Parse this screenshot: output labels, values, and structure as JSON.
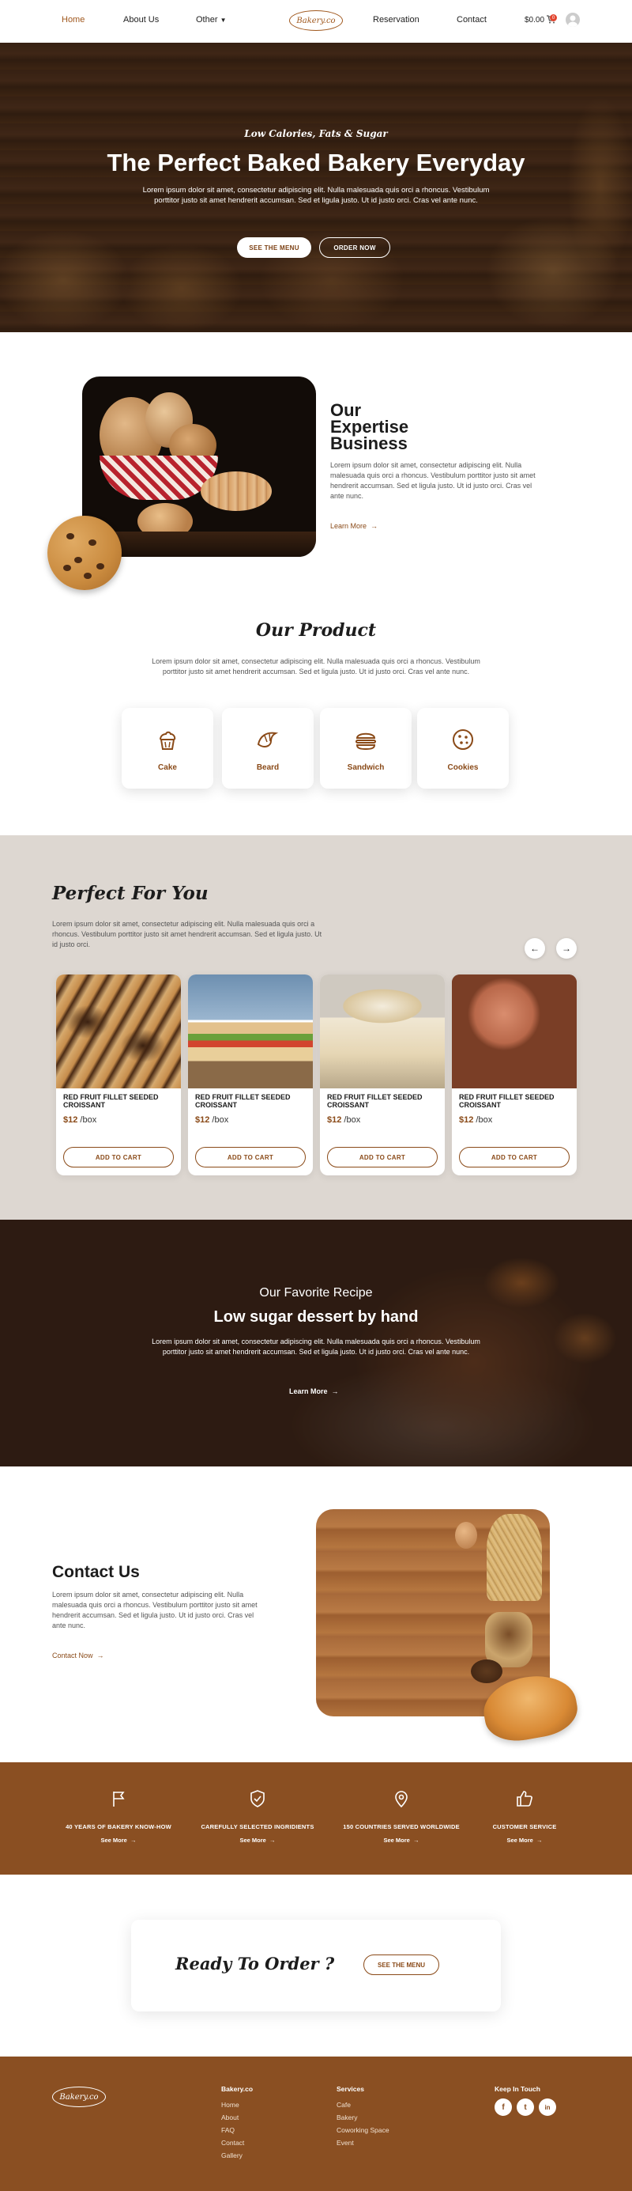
{
  "nav": {
    "home": "Home",
    "about": "About Us",
    "other": "Other",
    "logo": "Bakery.co",
    "reservation": "Reservation",
    "contact": "Contact",
    "cart_amount": "$0.00",
    "cart_count": "0"
  },
  "hero": {
    "tagline": "Low Calories, Fats & Sugar",
    "title": "The Perfect Baked Bakery Everyday",
    "body": "Lorem ipsum dolor sit amet, consectetur adipiscing elit. Nulla malesuada quis orci a rhoncus. Vestibulum porttitor justo sit amet hendrerit accumsan. Sed et ligula justo. Ut id justo orci. Cras vel ante nunc.",
    "btn_menu": "SEE THE MENU",
    "btn_order": "ORDER NOW"
  },
  "about": {
    "title_line1": "Our",
    "title_line2": "Expertise",
    "title_line3": "Business",
    "body": "Lorem ipsum dolor sit amet, consectetur adipiscing elit. Nulla malesuada quis orci a rhoncus. Vestibulum porttitor justo sit amet hendrerit accumsan. Sed et ligula justo. Ut id justo orci. Cras vel ante nunc.",
    "link": "Learn More"
  },
  "product": {
    "title": "Our Product",
    "body": "Lorem ipsum dolor sit amet, consectetur adipiscing elit. Nulla malesuada quis orci a rhoncus. Vestibulum porttitor justo sit amet hendrerit accumsan. Sed et ligula justo. Ut id justo orci. Cras vel ante nunc.",
    "categories": [
      {
        "label": "Cake",
        "icon": "cupcake-icon"
      },
      {
        "label": "Beard",
        "icon": "croissant-icon"
      },
      {
        "label": "Sandwich",
        "icon": "burger-icon"
      },
      {
        "label": "Cookies",
        "icon": "cookie-icon"
      }
    ]
  },
  "perfect": {
    "title": "Perfect For You",
    "body": "Lorem ipsum dolor sit amet, consectetur adipiscing elit. Nulla malesuada quis orci a rhoncus. Vestibulum porttitor justo sit amet hendrerit accumsan. Sed et ligula justo. Ut id justo orci.",
    "items": [
      {
        "name": "RED FRUIT FILLET SEEDED CROISSANT",
        "price": "$12",
        "unit": "/box",
        "cta": "ADD TO CART"
      },
      {
        "name": "RED FRUIT FILLET SEEDED CROISSANT",
        "price": "$12",
        "unit": "/box",
        "cta": "ADD TO CART"
      },
      {
        "name": "RED FRUIT FILLET SEEDED CROISSANT",
        "price": "$12",
        "unit": "/box",
        "cta": "ADD TO CART"
      },
      {
        "name": "RED FRUIT FILLET SEEDED CROISSANT",
        "price": "$12",
        "unit": "/box",
        "cta": "ADD TO CART"
      }
    ]
  },
  "recipe": {
    "kicker": "Our Favorite Recipe",
    "title": "Low sugar dessert by hand",
    "body": "Lorem ipsum dolor sit amet, consectetur adipiscing elit. Nulla malesuada quis orci a rhoncus. Vestibulum porttitor justo sit amet hendrerit accumsan. Sed et ligula justo. Ut id justo orci. Cras vel ante nunc.",
    "link": "Learn More"
  },
  "contact": {
    "title": "Contact Us",
    "body": "Lorem ipsum dolor sit amet, consectetur adipiscing elit. Nulla malesuada quis orci a rhoncus. Vestibulum porttitor justo sit amet hendrerit accumsan. Sed et ligula justo. Ut id justo orci. Cras vel ante nunc.",
    "link": "Contact Now"
  },
  "features": [
    {
      "title": "40 YEARS OF BAKERY KNOW-HOW",
      "link": "See More",
      "icon": "flag-icon"
    },
    {
      "title": "CAREFULLY SELECTED INGRIDIENTS",
      "link": "See More",
      "icon": "shield-check-icon"
    },
    {
      "title": "150 COUNTRIES SERVED WORLDWIDE",
      "link": "See More",
      "icon": "map-pin-icon"
    },
    {
      "title": "CUSTOMER SERVICE",
      "link": "See More",
      "icon": "thumbs-up-icon"
    }
  ],
  "ready": {
    "title": "Ready To Order ?",
    "btn": "SEE THE MENU"
  },
  "footer": {
    "logo": "Bakery.co",
    "col1_title": "Bakery.co",
    "col1_links": [
      "Home",
      "About",
      "FAQ",
      "Contact",
      "Gallery"
    ],
    "col2_title": "Services",
    "col2_links": [
      "Cafe",
      "Bakery",
      "Coworking Space",
      "Event"
    ],
    "col3_title": "Keep In Touch",
    "social": [
      {
        "label": "f",
        "icon": "facebook-icon"
      },
      {
        "label": "t",
        "icon": "twitter-icon"
      },
      {
        "label": "in",
        "icon": "instagram-icon"
      }
    ]
  },
  "colors": {
    "brand": "#8a4f22",
    "accent": "#a0581e",
    "cart_badge": "#e2452f",
    "section_bg": "#ddd7d1"
  }
}
